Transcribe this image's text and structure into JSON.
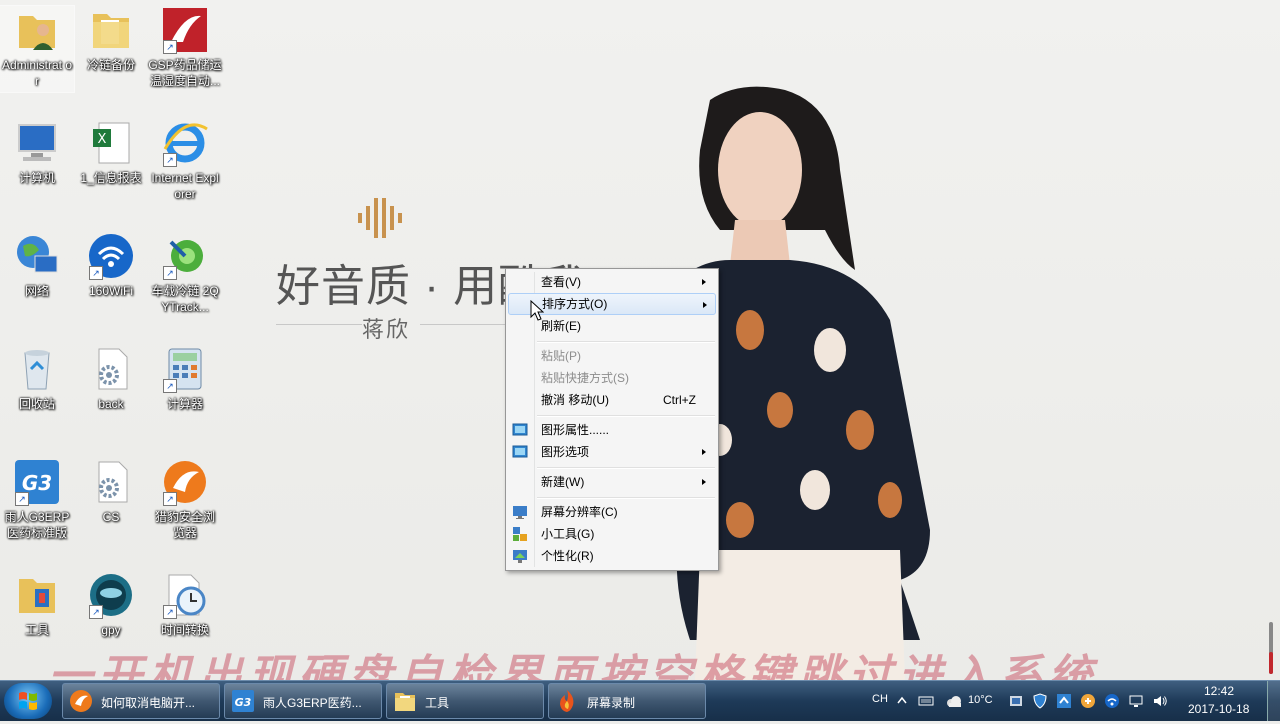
{
  "desktop": {
    "icons": [
      {
        "label": "Administrat or",
        "icon": "user-folder-icon"
      },
      {
        "label": "冷链备份",
        "icon": "folder-icon"
      },
      {
        "label": "GSP药品储运 温湿度自动...",
        "icon": "gsp-app-icon"
      },
      {
        "label": "计算机",
        "icon": "computer-icon"
      },
      {
        "label": "1_信息报表",
        "icon": "excel-file-icon"
      },
      {
        "label": "Internet Explorer",
        "icon": "ie-icon"
      },
      {
        "label": "网络",
        "icon": "network-icon"
      },
      {
        "label": "160WiFi",
        "icon": "wifi-icon"
      },
      {
        "label": "车载冷链 2QYTrack...",
        "icon": "track-app-icon"
      },
      {
        "label": "回收站",
        "icon": "recycle-bin-icon"
      },
      {
        "label": "back",
        "icon": "config-file-icon"
      },
      {
        "label": "计算器",
        "icon": "calculator-icon"
      },
      {
        "label": "雨人G3ERP 医药标准版",
        "icon": "g3-app-icon"
      },
      {
        "label": "CS",
        "icon": "config-file-icon"
      },
      {
        "label": "猎豹安全浏 览器",
        "icon": "cheetah-browser-icon"
      },
      {
        "label": "工具",
        "icon": "tools-folder-icon"
      },
      {
        "label": "gpy",
        "icon": "camera-app-icon"
      },
      {
        "label": "时间转换",
        "icon": "clock-app-icon"
      }
    ]
  },
  "wallpaper": {
    "slogan": "好音质 · 用酷我",
    "name": "蒋欣"
  },
  "context_menu": {
    "items": [
      {
        "label": "查看(V)",
        "submenu": true
      },
      {
        "label": "排序方式(O)",
        "submenu": true,
        "hover": true
      },
      {
        "label": "刷新(E)"
      },
      {
        "label": "粘贴(P)",
        "disabled": true
      },
      {
        "label": "粘贴快捷方式(S)",
        "disabled": true
      },
      {
        "label": "撤消 移动(U)",
        "shortcut": "Ctrl+Z"
      },
      {
        "label": "图形属性......",
        "icon": "graphics-properties-icon"
      },
      {
        "label": "图形选项",
        "submenu": true,
        "icon": "graphics-options-icon"
      },
      {
        "label": "新建(W)",
        "submenu": true
      },
      {
        "label": "屏幕分辨率(C)",
        "icon": "screen-resolution-icon"
      },
      {
        "label": "小工具(G)",
        "icon": "gadgets-icon"
      },
      {
        "label": "个性化(R)",
        "icon": "personalize-icon"
      }
    ]
  },
  "overlay_caption": "一开机出现硬盘自检界面按空格键跳过进入系统",
  "taskbar": {
    "buttons": [
      {
        "label": "如何取消电脑开...",
        "icon": "cheetah-browser-icon"
      },
      {
        "label": "雨人G3ERP医药...",
        "icon": "g3-app-icon"
      },
      {
        "label": "工具",
        "icon": "folder-icon"
      },
      {
        "label": "屏幕录制",
        "icon": "screen-record-icon"
      }
    ],
    "tray": {
      "lang": "CH",
      "temperature": "10°C",
      "time": "12:42",
      "date": "2017-10-18"
    }
  },
  "colors": {
    "overlay": "#cb5c6e",
    "taskbar": "#1e3a58",
    "menu_hover": "#dbe8f7"
  }
}
